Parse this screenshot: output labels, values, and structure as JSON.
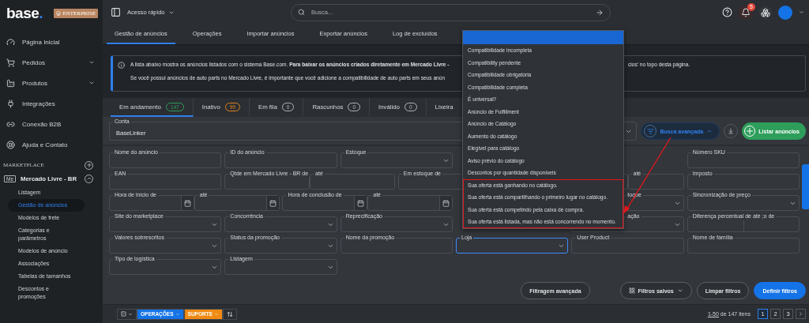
{
  "sidebar": {
    "logo": {
      "text": "base",
      "dot": "."
    },
    "plan_badge": "ENTERPRISE",
    "nav": [
      {
        "label": "Página Inicial",
        "expandable": false
      },
      {
        "label": "Pedidos",
        "expandable": true
      },
      {
        "label": "Produtos",
        "expandable": true
      },
      {
        "label": "Integrações",
        "expandable": false
      },
      {
        "label": "Conexão B2B",
        "expandable": false
      },
      {
        "label": "Ajuda e Contato",
        "expandable": false
      }
    ],
    "section_title": "MARKETPLACE",
    "marketplace": {
      "badge": "Me",
      "name": "Mercado Livre - BR",
      "expanded": true,
      "items": [
        {
          "label": "Listagem",
          "selected": false
        },
        {
          "label": "Gestão de anúncios",
          "selected": true
        },
        {
          "label": "Modelos de frete",
          "selected": false
        },
        {
          "label": "Categorias e parâmetros",
          "selected": false
        },
        {
          "label": "Modelos de anúncio",
          "selected": false
        },
        {
          "label": "Associações",
          "selected": false
        },
        {
          "label": "Tabelas de tamanhos",
          "selected": false
        },
        {
          "label": "Descontos e promoções",
          "selected": false
        }
      ]
    }
  },
  "topbar": {
    "quick_access": "Acesso rápido",
    "search": {
      "placeholder": "Busca..."
    },
    "notification_count": "5"
  },
  "subtabs": [
    {
      "label": "Gestão de anúncios",
      "selected": true
    },
    {
      "label": "Operações",
      "selected": false
    },
    {
      "label": "Importar anúncios",
      "selected": false
    },
    {
      "label": "Exportar anúncios",
      "selected": false
    },
    {
      "label": "Log de excluídos",
      "selected": false
    }
  ],
  "banner": {
    "line1_left": "A lista abaixo mostra os anúncios listados com o sistema Base.com. **Para baixar os anúncios criados diretamente em Mercado Livre -**",
    "line1_right": "cios' no topo desta página.",
    "line2": "Se você possui anúncios de auto parts no Mercado Livre, é importante que você adicione a compatibilidade de auto parts em seus anún"
  },
  "status_tabs": [
    {
      "label": "Em andamento",
      "count": "147",
      "color": "#2e9e5b",
      "selected": true
    },
    {
      "label": "Inativo",
      "count": "99",
      "color": "#e0821e",
      "selected": false
    },
    {
      "label": "Em fila",
      "count": "0",
      "color": "#b4b8bd",
      "selected": false
    },
    {
      "label": "Rascunhos",
      "count": "0",
      "color": "#b4b8bd",
      "selected": false
    },
    {
      "label": "Inválido",
      "count": "0",
      "color": "#b4b8bd",
      "selected": false
    },
    {
      "label": "Lixeira",
      "selected": false
    }
  ],
  "filters": {
    "account": {
      "label": "Conta",
      "value": "BaseLinker"
    },
    "advanced_search": {
      "label": "Busca avançada",
      "active": true
    },
    "list_button": "Listar anúncios",
    "fields": [
      {
        "kind": "text",
        "label": "Nome do anúncio"
      },
      {
        "kind": "text",
        "label": "ID do anúncio"
      },
      {
        "kind": "select",
        "label": "Estoque"
      },
      {
        "kind": "covered"
      },
      {
        "kind": "covered"
      },
      {
        "kind": "text",
        "label": "Número SKU"
      },
      {
        "kind": "text",
        "label": "EAN"
      },
      {
        "kind": "wide_range",
        "label": "Qtde em Mercado Livre - BR de",
        "label2": "até"
      },
      {
        "kind": "wide_range",
        "label": "Em estoque de"
      },
      {
        "kind": "range",
        "label2": "até"
      },
      {
        "kind": "text",
        "label": "Imposto"
      },
      {
        "kind": "date_range",
        "label": "Hora de início de",
        "label2": "até"
      },
      {
        "kind": "date_range",
        "label": "Hora de conclusão de",
        "label2": "até"
      },
      {
        "kind": "covered"
      },
      {
        "kind": "select",
        "label": "toque",
        "clipped": true
      },
      {
        "kind": "select",
        "label": "Sincronização de preço"
      },
      {
        "kind": "select",
        "label": "Site do marketplace"
      },
      {
        "kind": "select",
        "label": "Concorrência"
      },
      {
        "kind": "select",
        "label": "Reprecificação"
      },
      {
        "kind": "covered"
      },
      {
        "kind": "select",
        "label": "ação",
        "clipped": true
      },
      {
        "kind": "split",
        "label": "Diferença percentual de até ;o de"
      },
      {
        "kind": "select",
        "label": "Valores sobrescritos"
      },
      {
        "kind": "select",
        "label": "Status da promoção"
      },
      {
        "kind": "text",
        "label": "Nome da promoção"
      },
      {
        "kind": "select",
        "label": "Loja",
        "focused": true
      },
      {
        "kind": "text",
        "label": "User Product"
      },
      {
        "kind": "text",
        "label": "Nome de família"
      },
      {
        "kind": "select",
        "label": "Tipo de logística"
      },
      {
        "kind": "select",
        "label": "Listagem"
      }
    ],
    "buttons": {
      "advanced": "Filtragem avançada",
      "saved": "Filtros salvos",
      "clear": "Limpar filtros",
      "apply": "Definir filtros"
    }
  },
  "dropdown": {
    "blank_selected": true,
    "options": [
      {
        "label": "Compatibilidade incompleta",
        "highlighted": false
      },
      {
        "label": "Compatibility pendente",
        "highlighted": false
      },
      {
        "label": "Compatibilidade obrigatória",
        "highlighted": false
      },
      {
        "label": "Compatibilidade completa",
        "highlighted": false
      },
      {
        "label": "É universal?",
        "highlighted": false
      },
      {
        "label": "Anúncio de Fulfillment",
        "highlighted": false
      },
      {
        "label": "Anúncio de Catálogo",
        "highlighted": false
      },
      {
        "label": "Aumento do catálogo",
        "highlighted": false
      },
      {
        "label": "Elegível para catálogo",
        "highlighted": false
      },
      {
        "label": "Aviso prévio do catálogo",
        "highlighted": false
      },
      {
        "label": "Descontos por quantidade disponíveis",
        "highlighted": false
      },
      {
        "label": "Sua oferta está ganhando no catálogo.",
        "highlighted": true
      },
      {
        "label": "Sua oferta está compartilhando o primeiro lugar no catálogo.",
        "highlighted": true
      },
      {
        "label": "Sua oferta está competindo pela caixa de compra.",
        "highlighted": true
      },
      {
        "label": "Sua oferta está listada, mas não está concorrendo no momento.",
        "highlighted": true
      }
    ]
  },
  "footer": {
    "operations": "OPERAÇÕES",
    "support": "SUPORTE",
    "range": "1-50",
    "total": "de 147 itens",
    "pages": [
      {
        "label": "1",
        "selected": true
      },
      {
        "label": "2",
        "selected": false
      },
      {
        "label": "3",
        "selected": false
      }
    ]
  }
}
